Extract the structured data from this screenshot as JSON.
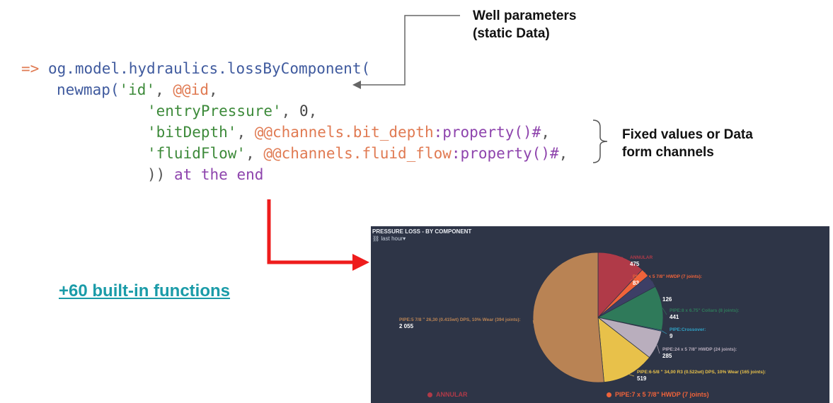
{
  "code": {
    "prompt": "=>",
    "call": "og.model.hydraulics.lossByComponent(",
    "newmap": "newmap(",
    "k_id": "'id'",
    "v_id": "@@id",
    "k_entry": "'entryPressure'",
    "v_entry": "0",
    "k_bit": "'bitDepth'",
    "v_bit_ch": "@@channels.bit_depth",
    "v_bit_prop": ":property()#",
    "k_flow": "'fluidFlow'",
    "v_flow_ch": "@@channels.fluid_flow",
    "v_flow_prop": ":property()#",
    "close": "))",
    "tail": "at the end"
  },
  "annotations": {
    "well_line1": "Well parameters",
    "well_line2": "(static Data)",
    "fixed_line1": "Fixed values or Data",
    "fixed_line2": "form channels"
  },
  "builtin_text": "+60 built-in functions",
  "dashboard": {
    "title": "PRESSURE LOSS - BY COMPONENT",
    "range_label": "last hour",
    "range_caret": "▾"
  },
  "chart_data": {
    "type": "pie",
    "title": "PRESSURE LOSS - BY COMPONENT",
    "slices": [
      {
        "label": "ANNULAR",
        "value": 475,
        "value_text": "475",
        "color": "#b03a48"
      },
      {
        "label": "PIPE:7 x 5 7/8\" HWDP (7 joints):",
        "value": 83,
        "value_text": "83",
        "color": "#f0633a"
      },
      {
        "label": "",
        "value": 126,
        "value_text": "126",
        "color": "#3d3f66"
      },
      {
        "label": "PIPE:8 x 6.75\" Collars (8 joints):",
        "value": 441,
        "value_text": "441",
        "color": "#2f7a5a"
      },
      {
        "label": "PIPE:Crossover:",
        "value": 9,
        "value_text": "9",
        "color": "#2fa3c7"
      },
      {
        "label": "PIPE:24 x 5 7/8\" HWDP (24 joints):",
        "value": 285,
        "value_text": "285",
        "color": "#b9aebd"
      },
      {
        "label": "PIPE:6-5/8 \" 34,00 R3 (0.522wt) DPS, 10% Wear (165 joints):",
        "value": 519,
        "value_text": "519",
        "color": "#e8c14a"
      },
      {
        "label": "PIPE:5 7/8 \" 26,30 (0.415wt) DPS, 10% Wear (394 joints):",
        "value": 2055,
        "value_text": "2 055",
        "color": "#b98354"
      }
    ],
    "legend": [
      {
        "label": "ANNULAR",
        "color": "#b03a48"
      },
      {
        "label": "PIPE:7 x 5 7/8\" HWDP (7 joints)",
        "color": "#f0633a"
      }
    ]
  }
}
